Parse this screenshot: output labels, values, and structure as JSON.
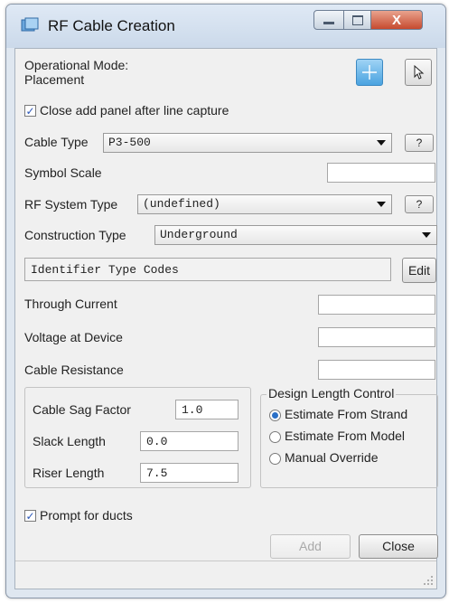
{
  "window": {
    "title": "RF Cable Creation",
    "close_glyph": "X"
  },
  "mode": {
    "label_line1": "Operational Mode:",
    "label_line2": "Placement",
    "tool_icons": [
      "crosshair-icon",
      "pointer-icon"
    ]
  },
  "close_after_capture": {
    "label": "Close add panel after line capture",
    "checked": true
  },
  "cable_type": {
    "label": "Cable Type",
    "value": "P3-500",
    "help": "?"
  },
  "symbol_scale": {
    "label": "Symbol Scale",
    "value": ""
  },
  "rf_system_type": {
    "label": "RF System Type",
    "value": "(undefined)",
    "help": "?"
  },
  "construction_type": {
    "label": "Construction Type",
    "value": "Underground"
  },
  "identifier": {
    "value": "Identifier Type Codes",
    "edit_label": "Edit"
  },
  "through_current": {
    "label": "Through Current",
    "value": ""
  },
  "voltage_at_device": {
    "label": "Voltage at Device",
    "value": ""
  },
  "cable_resistance": {
    "label": "Cable Resistance",
    "value": ""
  },
  "sag_group": {
    "sag_label": "Cable Sag Factor",
    "sag_value": "1.0",
    "slack_label": "Slack Length",
    "slack_value": "0.0",
    "riser_label": "Riser Length",
    "riser_value": "7.5"
  },
  "design_length": {
    "title": "Design Length Control",
    "options": [
      "Estimate From Strand",
      "Estimate From Model",
      "Manual Override"
    ],
    "selected_index": 0
  },
  "prompt_ducts": {
    "label": "Prompt for ducts",
    "checked": true
  },
  "buttons": {
    "add": "Add",
    "close": "Close"
  },
  "colors": {
    "accent": "#4aa3e0",
    "close_button": "#c64a2f",
    "check": "#2a56b8"
  }
}
